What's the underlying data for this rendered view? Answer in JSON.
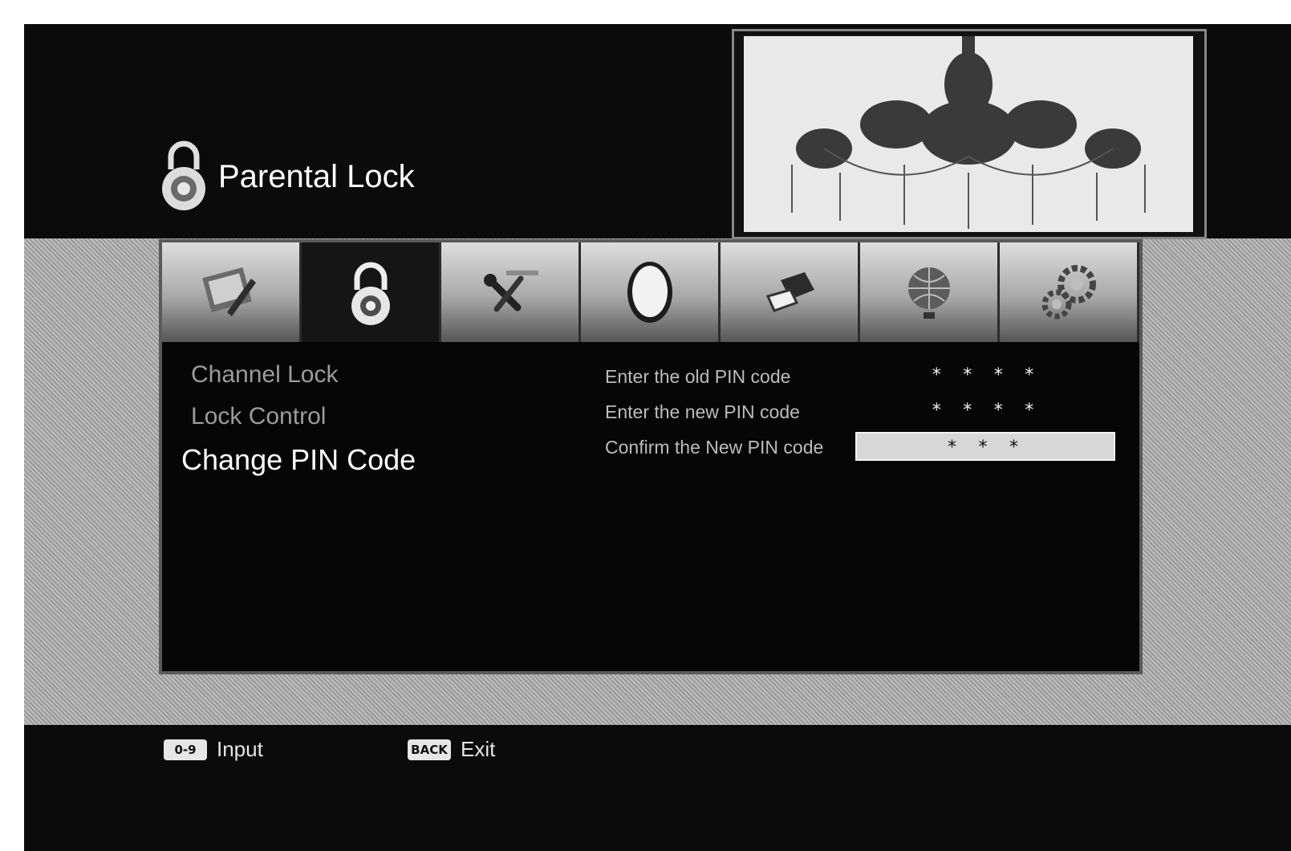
{
  "header": {
    "title": "Parental Lock",
    "icon": "padlock-icon"
  },
  "tabs": [
    {
      "icon": "picture-settings-icon",
      "active": false
    },
    {
      "icon": "padlock-icon",
      "active": true
    },
    {
      "icon": "tools-icon",
      "active": false
    },
    {
      "icon": "globe-outline-icon",
      "active": false
    },
    {
      "icon": "usb-device-icon",
      "active": false
    },
    {
      "icon": "network-globe-icon",
      "active": false
    },
    {
      "icon": "gears-icon",
      "active": false
    }
  ],
  "menu": {
    "items": [
      "Channel Lock",
      "Lock Control",
      "Change PIN Code"
    ],
    "selected_index": 2
  },
  "form": {
    "rows": [
      {
        "label": "Enter the old PIN code",
        "value": "* * * *"
      },
      {
        "label": "Enter the new PIN code",
        "value": "* * * *"
      },
      {
        "label": "Confirm the New PIN code",
        "value": "* * *"
      }
    ],
    "focused_index": 2
  },
  "footer": {
    "hints": [
      {
        "key": "0-9",
        "label": "Input"
      },
      {
        "key": "BACK",
        "label": "Exit"
      }
    ]
  }
}
